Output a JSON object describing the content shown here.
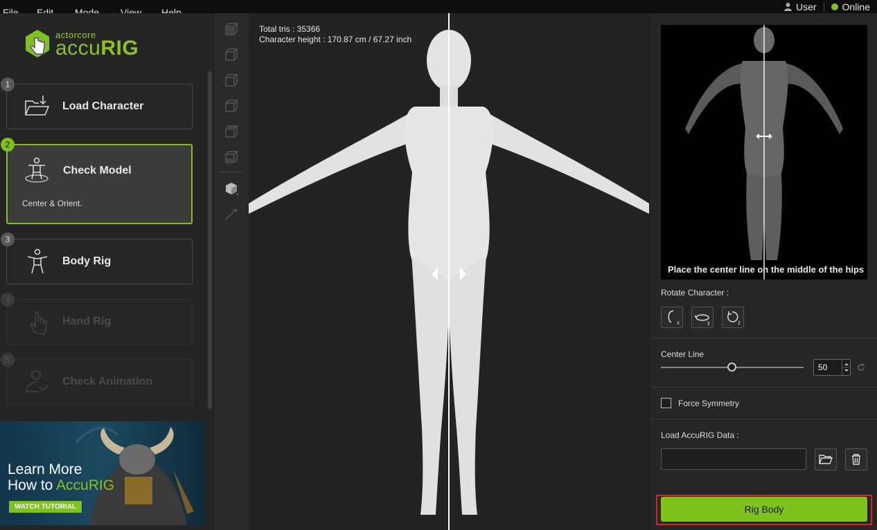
{
  "menu": {
    "items": [
      "File",
      "Edit",
      "Mode",
      "View",
      "Help"
    ],
    "user_label": "User",
    "status_label": "Online"
  },
  "logo": {
    "small": "actorcore",
    "big_left": "accu",
    "big_right": "RIG"
  },
  "steps": [
    {
      "num": "1",
      "label": "Load Character",
      "state": "done"
    },
    {
      "num": "2",
      "label": "Check Model",
      "sub": "Center & Orient.",
      "state": "active"
    },
    {
      "num": "3",
      "label": "Body Rig",
      "state": "available"
    },
    {
      "num": "4",
      "label": "Hand Rig",
      "state": "disabled"
    },
    {
      "num": "5",
      "label": "Check Animation",
      "state": "disabled"
    }
  ],
  "promo": {
    "line1": "Learn More",
    "line2_prefix": "How to ",
    "line2_accent": "AccuRIG",
    "button": "WATCH TUTORIAL"
  },
  "viewport": {
    "total_tris": "Total tris : 35366",
    "char_height": "Character height : 170.87 cm / 67.27 inch"
  },
  "right": {
    "preview_caption": "Place the center line on the middle of the hips",
    "rotate_label": "Rotate Character :",
    "rotate_buttons": [
      "rotate-x",
      "rotate-y",
      "rotate-z"
    ],
    "rotate_axis": [
      "x",
      "y",
      "z"
    ],
    "center_line_label": "Center Line",
    "center_line_value": "50",
    "force_symmetry_label": "Force Symmetry",
    "load_data_label": "Load AccuRIG Data :",
    "load_data_value": "",
    "rig_body_label": "Rig Body"
  },
  "colors": {
    "accent": "#7ec31c",
    "highlight_outline": "#e02020",
    "background": "#1e1e1e"
  }
}
